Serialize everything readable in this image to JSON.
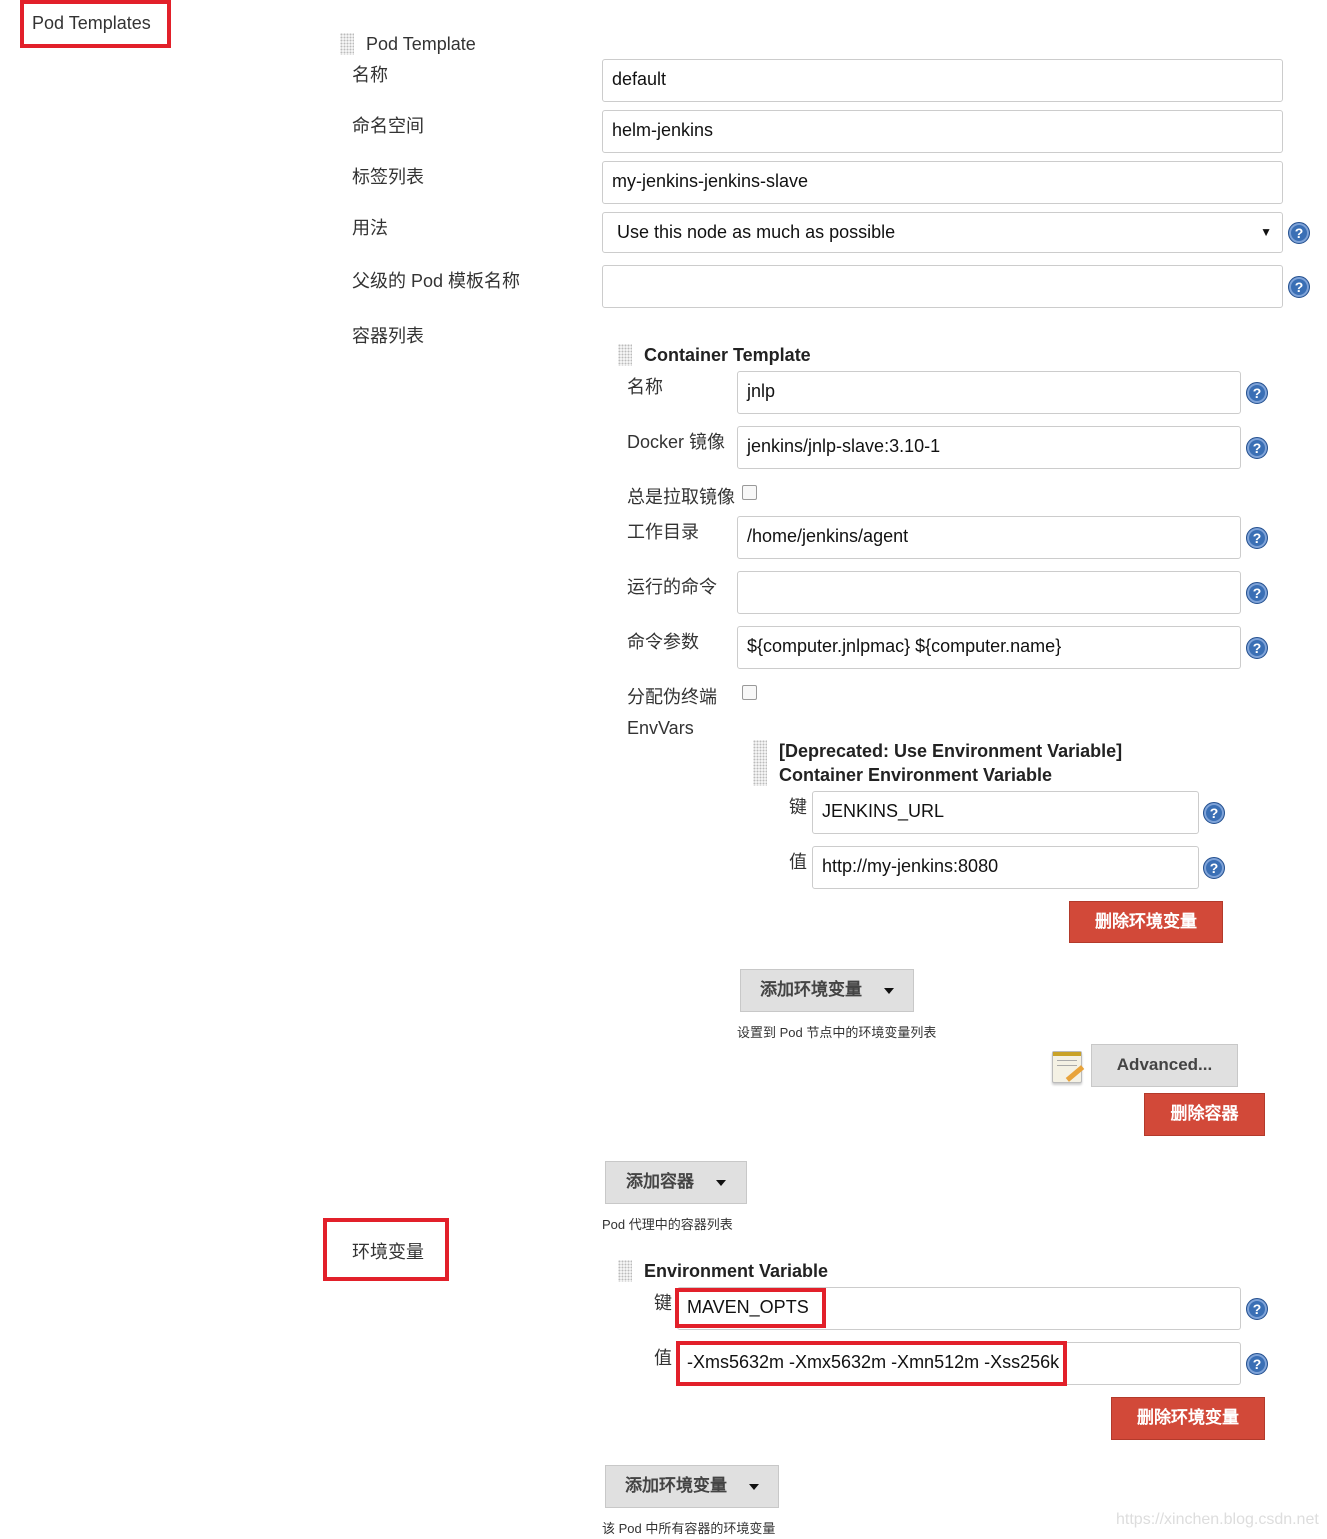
{
  "section_title": "Pod Templates",
  "pod_template": {
    "header": "Pod Template",
    "fields": [
      {
        "label": "名称",
        "value": "default"
      },
      {
        "label": "命名空间",
        "value": "helm-jenkins"
      },
      {
        "label": "标签列表",
        "value": "my-jenkins-jenkins-slave"
      },
      {
        "label": "用法",
        "value": "Use this node as much as possible"
      },
      {
        "label": "父级的 Pod 模板名称",
        "value": ""
      },
      {
        "label": "容器列表"
      }
    ]
  },
  "container_template": {
    "header": "Container Template",
    "name_label": "名称",
    "name_value": "jnlp",
    "image_label": "Docker 镜像",
    "image_value": "jenkins/jnlp-slave:3.10-1",
    "always_pull_label": "总是拉取镜像",
    "always_pull_checked": false,
    "workdir_label": "工作目录",
    "workdir_value": "/home/jenkins/agent",
    "command_label": "运行的命令",
    "command_value": "",
    "args_label": "命令参数",
    "args_value": "${computer.jnlpmac} ${computer.name}",
    "tty_label": "分配伪终端",
    "tty_checked": false,
    "envvars_label": "EnvVars",
    "envvar": {
      "header_line1": "[Deprecated: Use Environment Variable]",
      "header_line2": "Container Environment Variable",
      "key_label": "键",
      "key_value": "JENKINS_URL",
      "value_label": "值",
      "value_value": "http://my-jenkins:8080",
      "delete_label": "删除环境变量"
    },
    "add_envvar_label": "添加环境变量",
    "add_envvar_hint": "设置到 Pod 节点中的环境变量列表",
    "advanced_label": "Advanced...",
    "delete_container_label": "删除容器"
  },
  "add_container_label": "添加容器",
  "add_container_hint": "Pod 代理中的容器列表",
  "env_section": {
    "label": "环境变量",
    "header": "Environment Variable",
    "key_label": "键",
    "key_value": "MAVEN_OPTS",
    "value_label": "值",
    "value_value": "-Xms5632m -Xmx5632m -Xmn512m -Xss256k",
    "delete_label": "删除环境变量",
    "add_label": "添加环境变量",
    "hint": "该 Pod 中所有容器的环境变量"
  },
  "watermark": "https://xinchen.blog.csdn.net",
  "colors": {
    "highlight": "#e2202a",
    "danger": "#d24939",
    "help": "#3a6fb5"
  }
}
